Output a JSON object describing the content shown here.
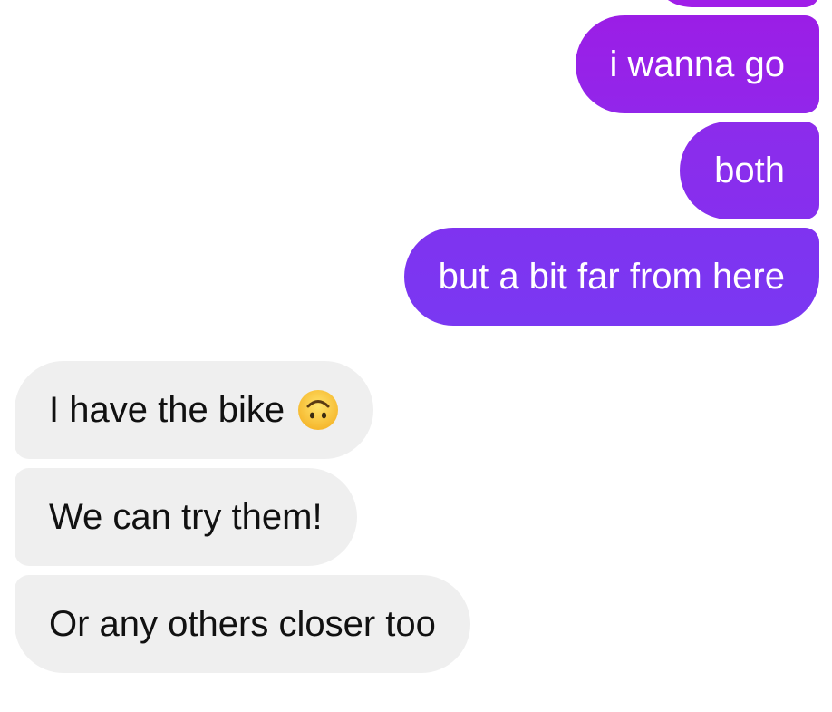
{
  "conversation": {
    "sent_messages": [
      {
        "text": "i wanna go"
      },
      {
        "text": "both"
      },
      {
        "text": "but a bit far from here"
      }
    ],
    "received_messages": [
      {
        "text": "I have the bike",
        "emoji": "upside-down-face-icon"
      },
      {
        "text": "We can try them!"
      },
      {
        "text": "Or any others closer too"
      }
    ]
  },
  "colors": {
    "sent_gradient_top": "#9b1ee6",
    "sent_gradient_bottom": "#7a38f2",
    "received_bubble": "#efefef",
    "received_text": "#111111",
    "sent_text": "#ffffff"
  }
}
